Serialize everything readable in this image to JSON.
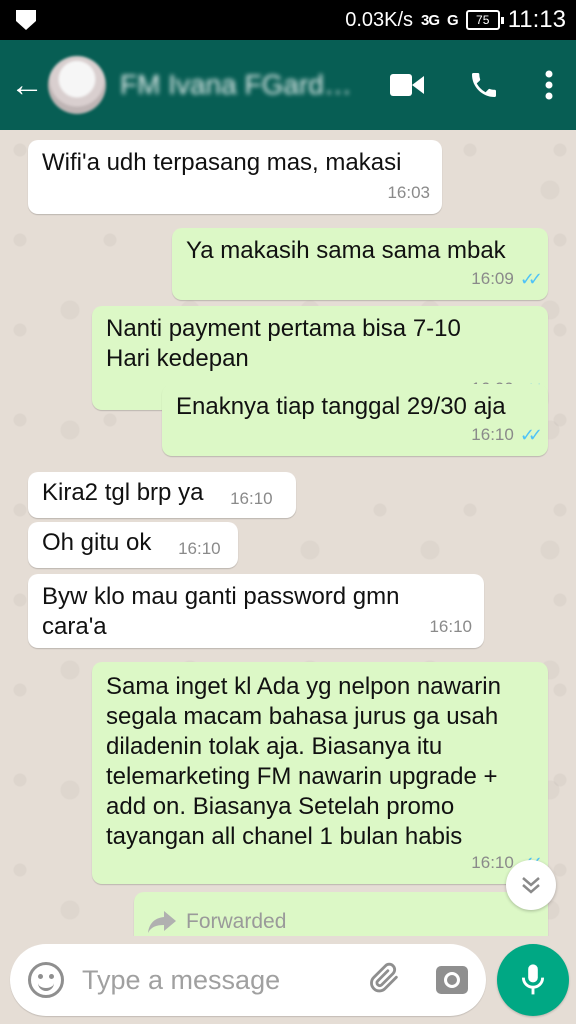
{
  "status_bar": {
    "net_speed": "0.03K/s",
    "network_1": "3G",
    "network_2": "G",
    "battery": "75",
    "time": "11:13"
  },
  "header": {
    "contact_name": "FM Ivana FGarde...",
    "icons": [
      "back-arrow-icon",
      "video-call-icon",
      "voice-call-icon",
      "more-options-icon"
    ]
  },
  "messages": [
    {
      "direction": "in",
      "text": "Wifi'a udh terpasang mas, makasi",
      "time": "16:03"
    },
    {
      "direction": "out",
      "text": "Ya makasih sama sama mbak",
      "time": "16:09",
      "read": true
    },
    {
      "direction": "out",
      "text": "Nanti payment pertama bisa 7-10 Hari kedepan",
      "time": "16:09",
      "read": true
    },
    {
      "direction": "out",
      "text": "Enaknya tiap tanggal 29/30 aja",
      "time": "16:10",
      "read": true
    },
    {
      "direction": "in",
      "text": "Kira2 tgl brp ya",
      "time": "16:10"
    },
    {
      "direction": "in",
      "text": "Oh gitu ok",
      "time": "16:10"
    },
    {
      "direction": "in",
      "text": "Byw klo mau ganti password gmn cara'a",
      "time": "16:10"
    },
    {
      "direction": "out",
      "text": "Sama inget kl Ada yg nelpon nawarin segala macam bahasa jurus ga usah diladenin tolak aja. Biasanya itu telemarketing FM nawarin upgrade + add on. Biasanya Setelah promo tayangan all chanel 1 bulan habis",
      "time": "16:10",
      "read": true
    }
  ],
  "forwarded_label": "Forwarded",
  "input": {
    "placeholder": "Type a message"
  },
  "colors": {
    "header": "#075e54",
    "incoming_bubble": "#ffffff",
    "outgoing_bubble": "#dcf8c6",
    "read_ticks": "#4fc3f7",
    "mic_button": "#00a884"
  }
}
